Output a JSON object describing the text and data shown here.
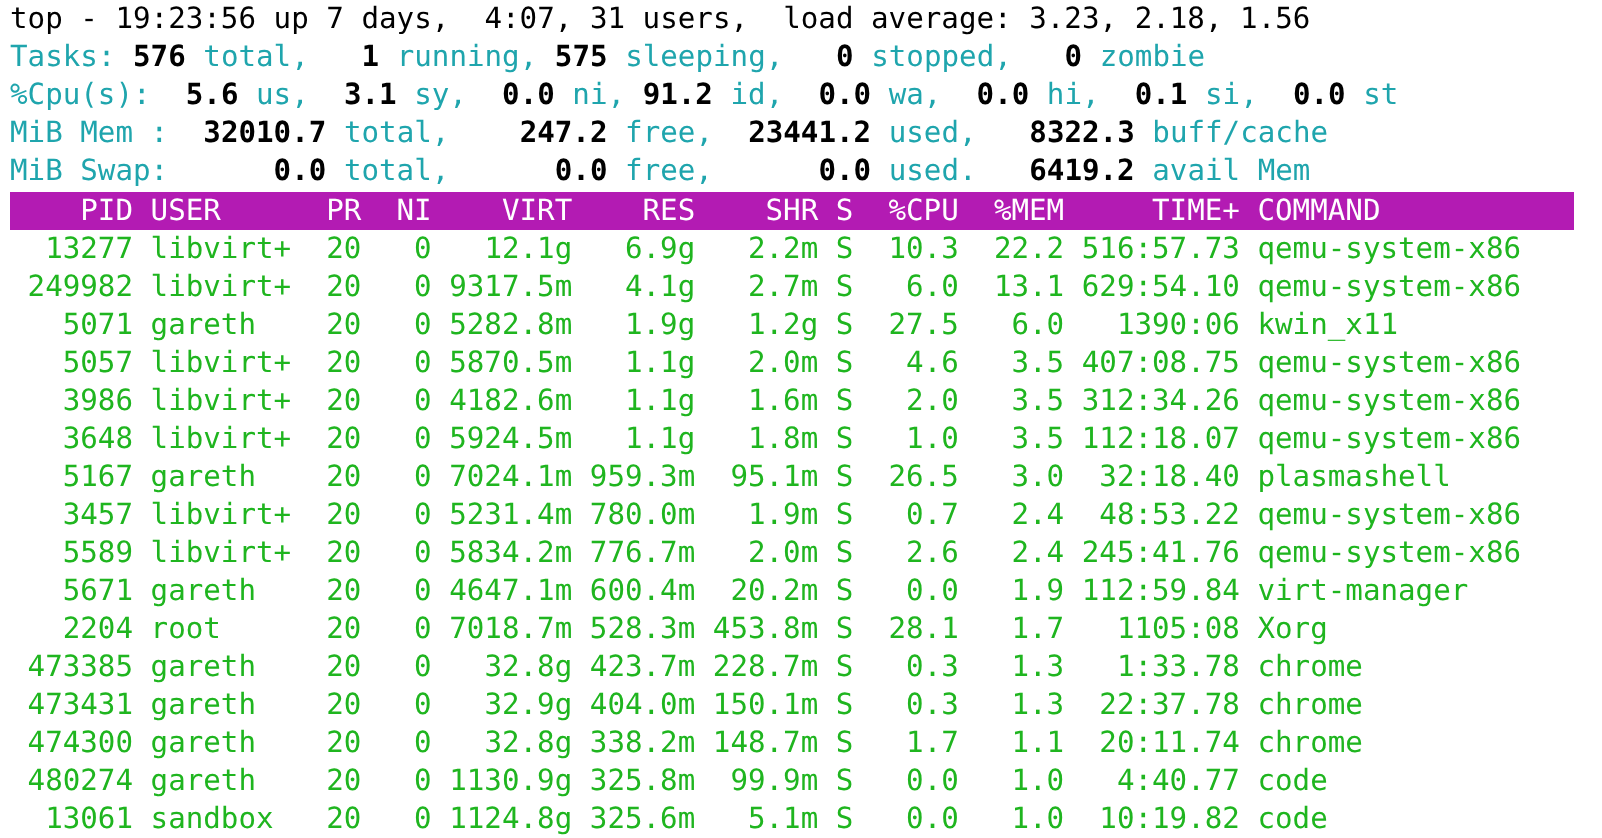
{
  "summary": [
    "top - 19:23:56 up 7 days,  4:07, 31 users,  load average: 3.23, 2.18, 1.56",
    "Tasks: **576** total,   **1** running, **575** sleeping,   **0** stopped,   **0** zombie",
    "%Cpu(s):  **5.6** us,  **3.1** sy,  **0.0** ni, **91.2** id,  **0.0** wa,  **0.0** hi,  **0.1** si,  **0.0** st",
    "MiB Mem :  **32010.7** total,    **247.2** free,  **23441.2** used,   **8322.3** buff/cache",
    "MiB Swap:      **0.0** total,      **0.0** free,      **0.0** used.   **6419.2** avail Mem"
  ],
  "table": {
    "columns": [
      "PID",
      "USER",
      "PR",
      "NI",
      "VIRT",
      "RES",
      "SHR",
      "S",
      "%CPU",
      "%MEM",
      "TIME+",
      "COMMAND"
    ],
    "rows": [
      [
        "13277",
        "libvirt+",
        "20",
        "0",
        "12.1g",
        "6.9g",
        "2.2m",
        "S",
        "10.3",
        "22.2",
        "516:57.73",
        "qemu-system-x86"
      ],
      [
        "249982",
        "libvirt+",
        "20",
        "0",
        "9317.5m",
        "4.1g",
        "2.7m",
        "S",
        "6.0",
        "13.1",
        "629:54.10",
        "qemu-system-x86"
      ],
      [
        "5071",
        "gareth",
        "20",
        "0",
        "5282.8m",
        "1.9g",
        "1.2g",
        "S",
        "27.5",
        "6.0",
        "1390:06",
        "kwin_x11"
      ],
      [
        "5057",
        "libvirt+",
        "20",
        "0",
        "5870.5m",
        "1.1g",
        "2.0m",
        "S",
        "4.6",
        "3.5",
        "407:08.75",
        "qemu-system-x86"
      ],
      [
        "3986",
        "libvirt+",
        "20",
        "0",
        "4182.6m",
        "1.1g",
        "1.6m",
        "S",
        "2.0",
        "3.5",
        "312:34.26",
        "qemu-system-x86"
      ],
      [
        "3648",
        "libvirt+",
        "20",
        "0",
        "5924.5m",
        "1.1g",
        "1.8m",
        "S",
        "1.0",
        "3.5",
        "112:18.07",
        "qemu-system-x86"
      ],
      [
        "5167",
        "gareth",
        "20",
        "0",
        "7024.1m",
        "959.3m",
        "95.1m",
        "S",
        "26.5",
        "3.0",
        "32:18.40",
        "plasmashell"
      ],
      [
        "3457",
        "libvirt+",
        "20",
        "0",
        "5231.4m",
        "780.0m",
        "1.9m",
        "S",
        "0.7",
        "2.4",
        "48:53.22",
        "qemu-system-x86"
      ],
      [
        "5589",
        "libvirt+",
        "20",
        "0",
        "5834.2m",
        "776.7m",
        "2.0m",
        "S",
        "2.6",
        "2.4",
        "245:41.76",
        "qemu-system-x86"
      ],
      [
        "5671",
        "gareth",
        "20",
        "0",
        "4647.1m",
        "600.4m",
        "20.2m",
        "S",
        "0.0",
        "1.9",
        "112:59.84",
        "virt-manager"
      ],
      [
        "2204",
        "root",
        "20",
        "0",
        "7018.7m",
        "528.3m",
        "453.8m",
        "S",
        "28.1",
        "1.7",
        "1105:08",
        "Xorg"
      ],
      [
        "473385",
        "gareth",
        "20",
        "0",
        "32.8g",
        "423.7m",
        "228.7m",
        "S",
        "0.3",
        "1.3",
        "1:33.78",
        "chrome"
      ],
      [
        "473431",
        "gareth",
        "20",
        "0",
        "32.9g",
        "404.0m",
        "150.1m",
        "S",
        "0.3",
        "1.3",
        "22:37.78",
        "chrome"
      ],
      [
        "474300",
        "gareth",
        "20",
        "0",
        "32.8g",
        "338.2m",
        "148.7m",
        "S",
        "1.7",
        "1.1",
        "20:11.74",
        "chrome"
      ],
      [
        "480274",
        "gareth",
        "20",
        "0",
        "1130.9g",
        "325.8m",
        "99.9m",
        "S",
        "0.0",
        "1.0",
        "4:40.77",
        "code"
      ],
      [
        "13061",
        "sandbox",
        "20",
        "0",
        "1124.8g",
        "325.6m",
        "5.1m",
        "S",
        "0.0",
        "1.0",
        "10:19.82",
        "code"
      ]
    ]
  }
}
